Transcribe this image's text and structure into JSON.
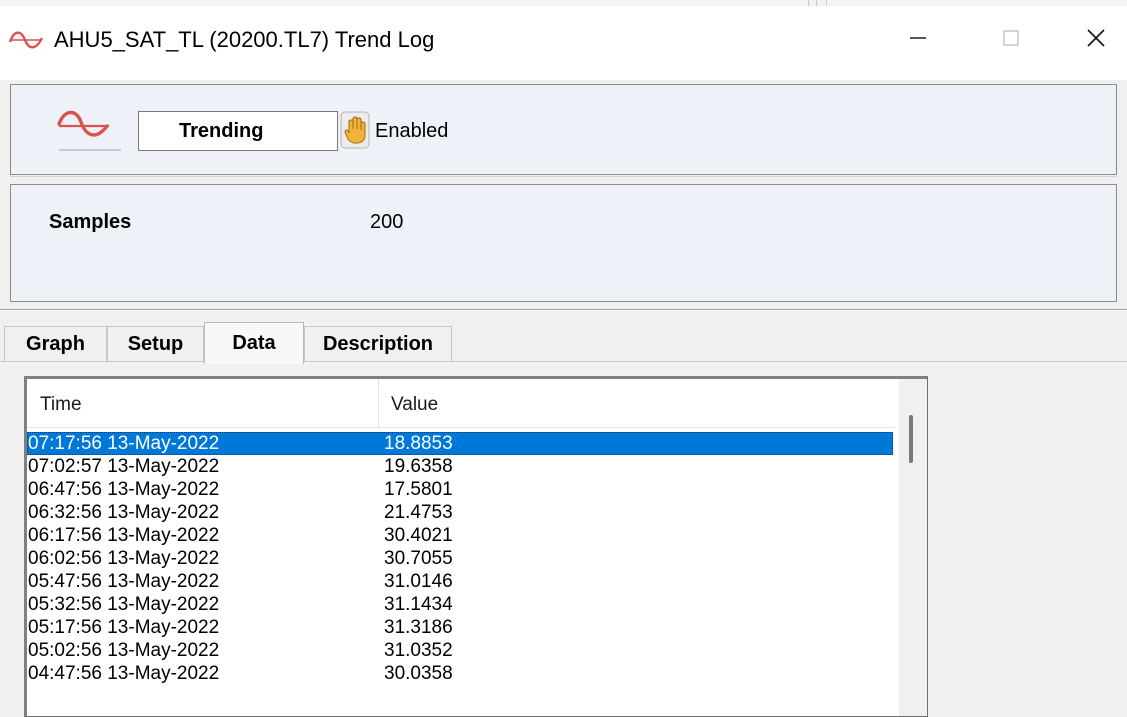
{
  "window": {
    "title": "AHU5_SAT_TL  (20200.TL7)  Trend Log",
    "title_icon": "trend-wave-icon",
    "controls": {
      "minimize": "minimize-icon",
      "maximize": "maximize-icon",
      "close": "close-icon"
    }
  },
  "status": {
    "icon": "trend-log-icon",
    "state": "Trending",
    "enabled_icon": "hand-icon",
    "enabled_label": "Enabled"
  },
  "samples": {
    "label": "Samples",
    "value": "200"
  },
  "tabs": [
    {
      "label": "Graph",
      "active": false
    },
    {
      "label": "Setup",
      "active": false
    },
    {
      "label": "Data",
      "active": true
    },
    {
      "label": "Description",
      "active": false
    }
  ],
  "table": {
    "columns": [
      "Time",
      "Value"
    ],
    "rows": [
      {
        "time": "07:17:56 13-May-2022",
        "value": "18.8853",
        "selected": true
      },
      {
        "time": "07:02:57 13-May-2022",
        "value": "19.6358",
        "selected": false
      },
      {
        "time": "06:47:56 13-May-2022",
        "value": "17.5801",
        "selected": false
      },
      {
        "time": "06:32:56 13-May-2022",
        "value": "21.4753",
        "selected": false
      },
      {
        "time": "06:17:56 13-May-2022",
        "value": "30.4021",
        "selected": false
      },
      {
        "time": "06:02:56 13-May-2022",
        "value": "30.7055",
        "selected": false
      },
      {
        "time": "05:47:56 13-May-2022",
        "value": "31.0146",
        "selected": false
      },
      {
        "time": "05:32:56 13-May-2022",
        "value": "31.1434",
        "selected": false
      },
      {
        "time": "05:17:56 13-May-2022",
        "value": "31.3186",
        "selected": false
      },
      {
        "time": "05:02:56 13-May-2022",
        "value": "31.0352",
        "selected": false
      },
      {
        "time": "04:47:56 13-May-2022",
        "value": "30.0358",
        "selected": false
      }
    ]
  },
  "colors": {
    "selection": "#0078d7",
    "panel_background": "#eef2f8",
    "icon_red": "#d9534f"
  }
}
